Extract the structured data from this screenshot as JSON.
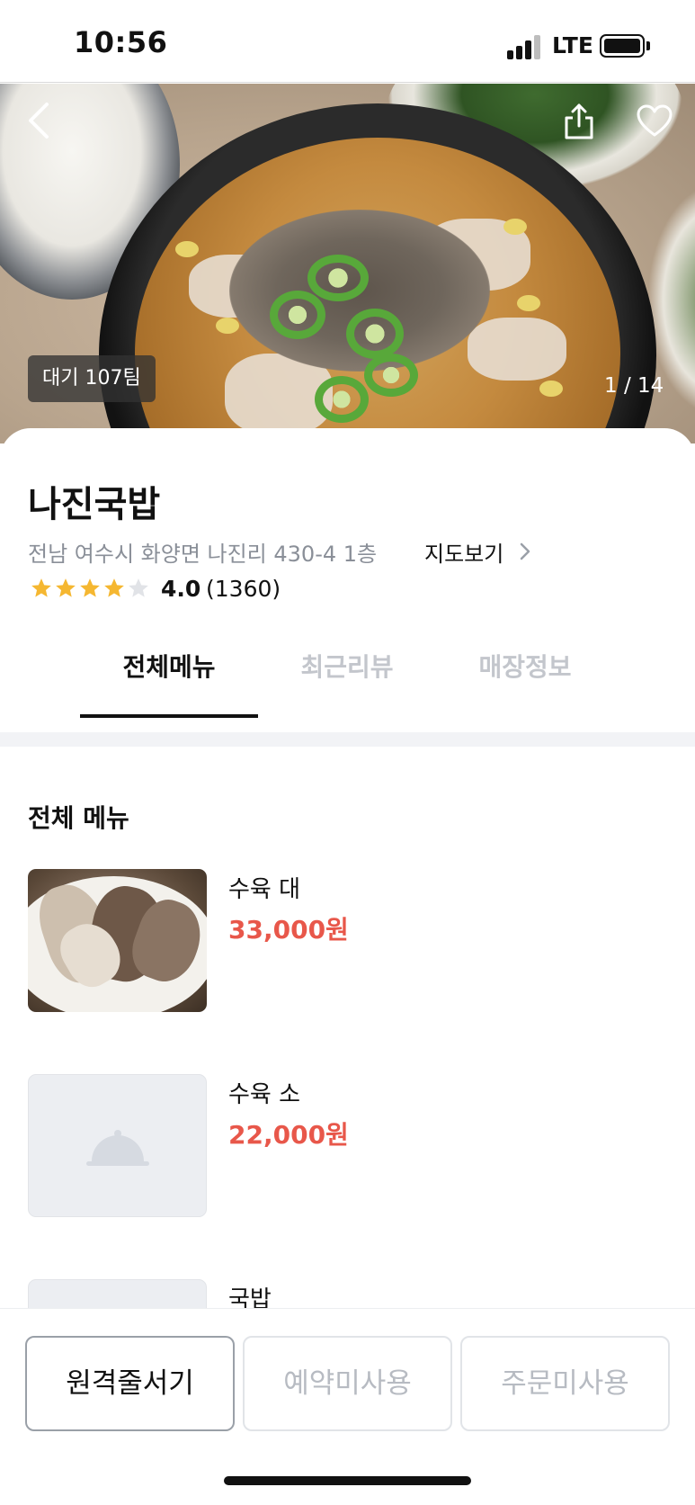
{
  "status_bar": {
    "time": "10:56",
    "network": "LTE"
  },
  "hero": {
    "wait_badge": "대기 107팀",
    "photo_counter": "1 / 14"
  },
  "store": {
    "name": "나진국밥",
    "address": "전남 여수시 화양면 나진리 430-4 1층",
    "map_link": "지도보기",
    "rating_score": "4.0",
    "rating_count": "(1360)",
    "rating_value": 4.0,
    "rating_max": 5
  },
  "tabs": [
    {
      "label": "전체메뉴",
      "active": true
    },
    {
      "label": "최근리뷰",
      "active": false
    },
    {
      "label": "매장정보",
      "active": false
    }
  ],
  "menu": {
    "section_title": "전체 메뉴",
    "items": [
      {
        "name": "수육 대",
        "price": "33,000원",
        "has_photo": true
      },
      {
        "name": "수육 소",
        "price": "22,000원",
        "has_photo": false
      },
      {
        "name": "국밥",
        "price": "",
        "has_photo": false
      }
    ]
  },
  "bottom_bar": {
    "buttons": [
      {
        "label": "원격줄서기",
        "enabled": true
      },
      {
        "label": "예약미사용",
        "enabled": false
      },
      {
        "label": "주문미사용",
        "enabled": false
      }
    ]
  },
  "colors": {
    "price": "#e8574a",
    "star": "#f5b731",
    "tab_active": "#111111",
    "tab_inactive": "#c3c6cc"
  },
  "icons": [
    "back-icon",
    "share-icon",
    "heart-icon",
    "chevron-right-icon",
    "star-icon",
    "cloche-icon"
  ]
}
